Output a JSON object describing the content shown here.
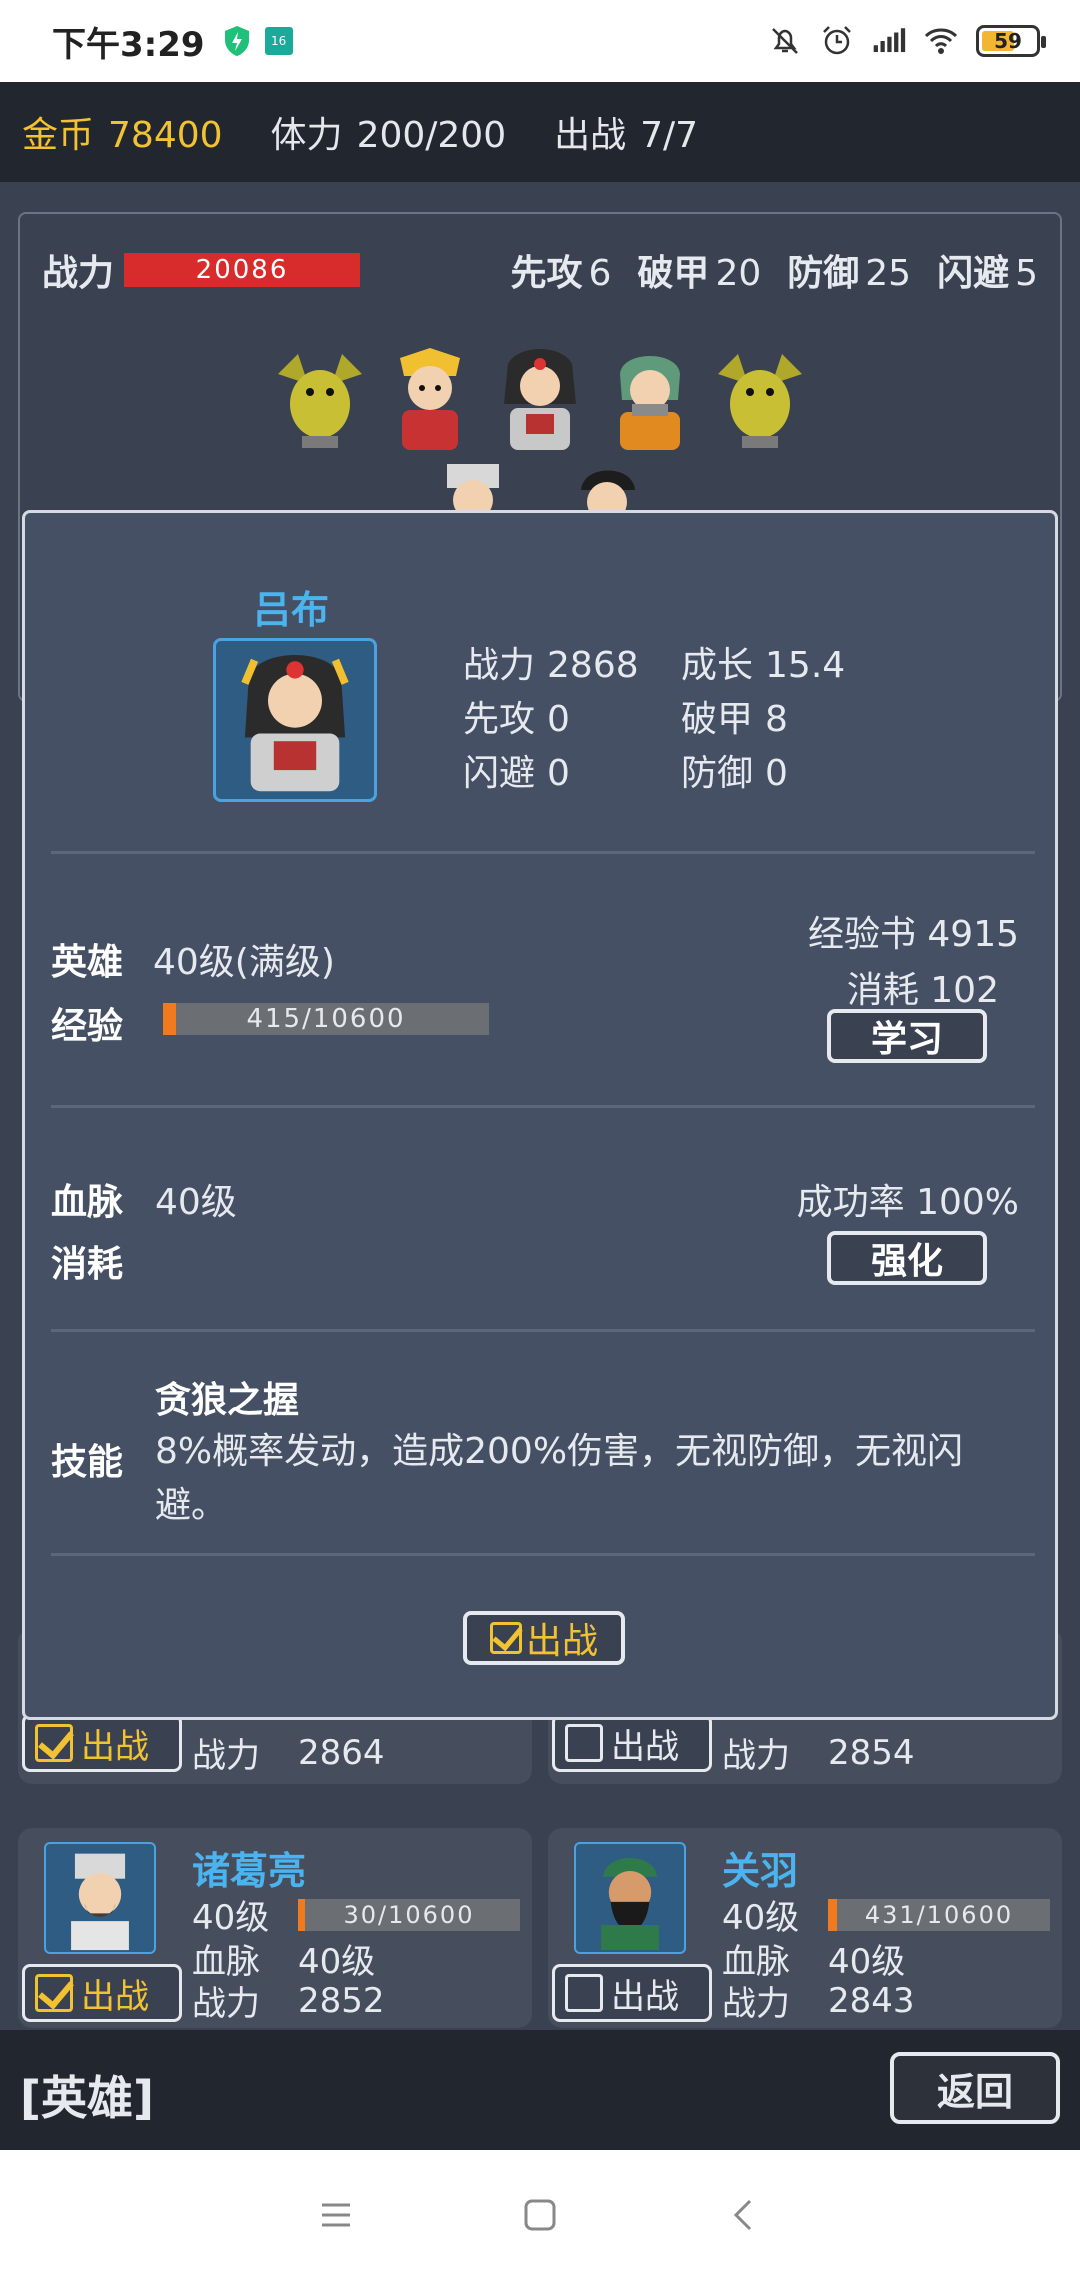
{
  "status_bar": {
    "time": "下午3:29",
    "battery": "59",
    "app_badge": "16"
  },
  "resources": {
    "gold_label": "金币",
    "gold_value": "78400",
    "stamina_label": "体力",
    "stamina_value": "200/200",
    "deploy_label": "出战",
    "deploy_value": "7/7"
  },
  "team": {
    "power_label": "战力",
    "power_value": "20086",
    "stats": [
      {
        "label": "先攻",
        "value": "6"
      },
      {
        "label": "破甲",
        "value": "20"
      },
      {
        "label": "防御",
        "value": "25"
      },
      {
        "label": "闪避",
        "value": "5"
      }
    ]
  },
  "modal": {
    "hero_name": "吕布",
    "stats": {
      "power_label": "战力",
      "power_value": "2868",
      "growth_label": "成长",
      "growth_value": "15.4",
      "initiative_label": "先攻",
      "initiative_value": "0",
      "armor_break_label": "破甲",
      "armor_break_value": "8",
      "dodge_label": "闪避",
      "dodge_value": "0",
      "defense_label": "防御",
      "defense_value": "0"
    },
    "hero_label": "英雄",
    "hero_level": "40级(满级)",
    "exp_label": "经验",
    "exp_value": "415/10600",
    "exp_progress": 0.039,
    "exp_book": "经验书 4915",
    "consume": "消耗 102",
    "learn_button": "学习",
    "bloodline_label": "血脉",
    "bloodline_level": "40级",
    "consume_label": "消耗",
    "success_rate": "成功率 100%",
    "strengthen_button": "强化",
    "skill_label": "技能",
    "skill_name": "贪狼之握",
    "skill_desc": "8%概率发动，造成200%伤害，无视防御，无视闪避。",
    "deploy_button": "出战"
  },
  "cards_partial": [
    {
      "deploy": "出战",
      "deployed": true,
      "power_label": "战力",
      "power_value": "2864"
    },
    {
      "deploy": "出战",
      "deployed": false,
      "power_label": "战力",
      "power_value": "2854"
    }
  ],
  "cards": [
    {
      "name": "诸葛亮",
      "level": "40级",
      "exp": "30/10600",
      "exp_progress": 0.003,
      "bloodline_label": "血脉",
      "bloodline": "40级",
      "power_label": "战力",
      "power": "2852",
      "deploy": "出战",
      "deployed": true
    },
    {
      "name": "关羽",
      "level": "40级",
      "exp": "431/10600",
      "exp_progress": 0.04,
      "bloodline_label": "血脉",
      "bloodline": "40级",
      "power_label": "战力",
      "power": "2843",
      "deploy": "出战",
      "deployed": false
    }
  ],
  "bottom": {
    "title": "[英雄]",
    "back_button": "返回"
  },
  "colors": {
    "accent_gold": "#f1c232",
    "hero_name_blue": "#4bb4ef",
    "power_red": "#d82b2b",
    "exp_orange": "#f07b1e"
  }
}
